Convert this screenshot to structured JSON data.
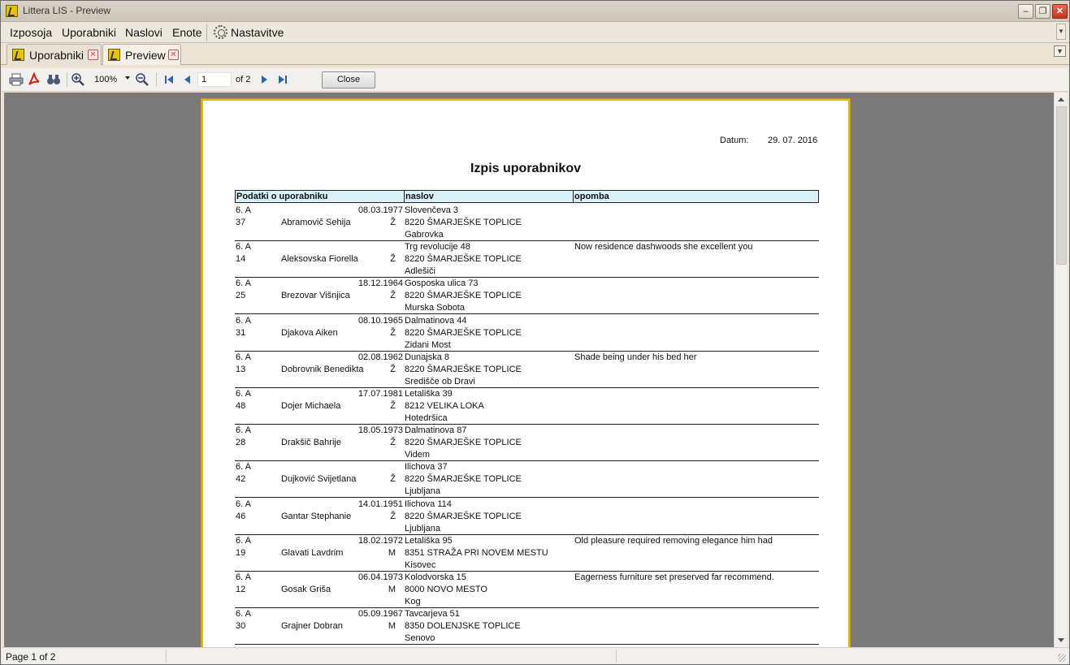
{
  "window": {
    "title": "Littera LIS - Preview",
    "min": "–",
    "max": "❐",
    "close": "✕"
  },
  "menu": {
    "items": [
      "Izposoja",
      "Uporabniki",
      "Naslovi",
      "Enote"
    ],
    "settings": "Nastavitve"
  },
  "tabs": [
    {
      "label": "Uporabniki",
      "close": "✕"
    },
    {
      "label": "Preview",
      "close": "✕"
    }
  ],
  "toolbar": {
    "zoom": "100%",
    "page_value": "1",
    "page_of": "of 2",
    "close_label": "Close"
  },
  "report": {
    "date_label": "Datum:",
    "date_value": "29. 07. 2016",
    "title": "Izpis uporabnikov",
    "columns": [
      "Podatki o uporabniku",
      "naslov",
      "opomba"
    ],
    "rows": [
      {
        "class": "6. A",
        "num": "37",
        "name": "Abramovič Sehija",
        "birth": "08.03.1977",
        "sex": "Ž",
        "street": "Slovenčeva 3",
        "city": "8220 ŠMARJEŠKE TOPLICE",
        "place": "Gabrovka",
        "note": ""
      },
      {
        "class": "6. A",
        "num": "14",
        "name": "Aleksovska Fiorella",
        "birth": "",
        "sex": "Ž",
        "street": "Trg revolucije 48",
        "city": "8220 ŠMARJEŠKE TOPLICE",
        "place": "Adlešiči",
        "note": "Now residence dashwoods she excellent you"
      },
      {
        "class": "6. A",
        "num": "25",
        "name": "Brezovar Višnjica",
        "birth": "18.12.1964",
        "sex": "Ž",
        "street": "Gosposka ulica 73",
        "city": "8220 ŠMARJEŠKE TOPLICE",
        "place": "Murska Sobota",
        "note": ""
      },
      {
        "class": "6. A",
        "num": "31",
        "name": "Djakova Aiken",
        "birth": "08.10.1965",
        "sex": "Ž",
        "street": "Dalmatinova 44",
        "city": "8220 ŠMARJEŠKE TOPLICE",
        "place": "Zidani Most",
        "note": ""
      },
      {
        "class": "6. A",
        "num": "13",
        "name": "Dobrovnik Benedikta",
        "birth": "02.08.1962",
        "sex": "Ž",
        "street": "Dunajska 8",
        "city": "8220 ŠMARJEŠKE TOPLICE",
        "place": "Središče ob Dravi",
        "note": "Shade being under his bed her"
      },
      {
        "class": "6. A",
        "num": "48",
        "name": "Dojer Michaela",
        "birth": "17.07.1981",
        "sex": "Ž",
        "street": "Letališka 39",
        "city": "8212 VELIKA LOKA",
        "place": "Hotedršica",
        "note": ""
      },
      {
        "class": "6. A",
        "num": "28",
        "name": "Drakšič Bahrije",
        "birth": "18.05.1973",
        "sex": "Ž",
        "street": "Dalmatinova 87",
        "city": "8220 ŠMARJEŠKE TOPLICE",
        "place": "Videm",
        "note": ""
      },
      {
        "class": "6. A",
        "num": "42",
        "name": "Dujković Svijetlana",
        "birth": "",
        "sex": "Ž",
        "street": "Ilichova 37",
        "city": "8220 ŠMARJEŠKE TOPLICE",
        "place": "Ljubljana",
        "note": ""
      },
      {
        "class": "6. A",
        "num": "46",
        "name": "Gantar Stephanie",
        "birth": "14.01.1951",
        "sex": "Ž",
        "street": "Ilichova 114",
        "city": "8220 ŠMARJEŠKE TOPLICE",
        "place": "Ljubljana",
        "note": ""
      },
      {
        "class": "6. A",
        "num": "19",
        "name": "Glavati Lavdrim",
        "birth": "18.02.1972",
        "sex": "M",
        "street": "Letališka 95",
        "city": "8351 STRAŽA PRI NOVEM MESTU",
        "place": "Kisovec",
        "note": "Old pleasure required removing elegance him had"
      },
      {
        "class": "6. A",
        "num": "12",
        "name": "Gosak Griša",
        "birth": "06.04.1973",
        "sex": "M",
        "street": "Kolodvorska 15",
        "city": "8000 NOVO MESTO",
        "place": "Kog",
        "note": "Eagerness furniture set preserved far recommend."
      },
      {
        "class": "6. A",
        "num": "30",
        "name": "Grajner Dobran",
        "birth": "05.09.1967",
        "sex": "M",
        "street": "Tavcarjeva 51",
        "city": "8350 DOLENJSKE TOPLICE",
        "place": "Senovo",
        "note": ""
      }
    ]
  },
  "status": {
    "page": "Page 1 of 2"
  }
}
